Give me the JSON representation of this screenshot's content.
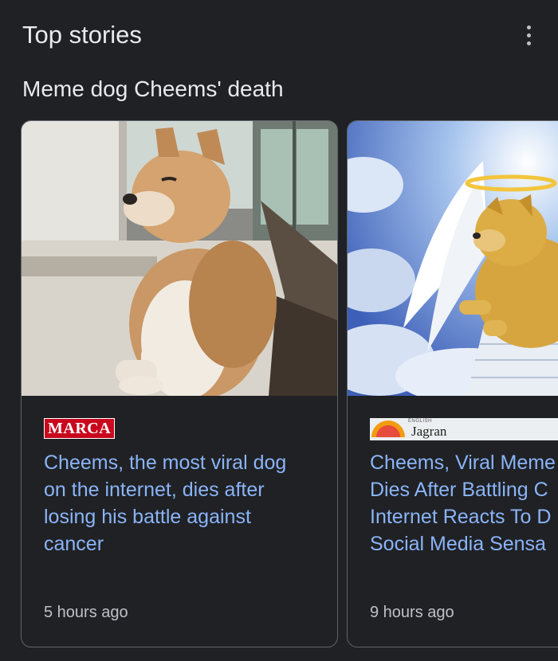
{
  "header": {
    "title": "Top stories",
    "more_icon": "more-vert-icon"
  },
  "topic": {
    "label": "Meme dog Cheems' death"
  },
  "colors": {
    "background": "#202124",
    "headline": "#8ab4f8",
    "text": "#e8eaed",
    "muted": "#bdc1c6",
    "border": "#5f6368"
  },
  "cards": [
    {
      "source": "MARCA",
      "headline_lines": [
        "Cheems, the most viral dog",
        "on the internet, dies after",
        "losing his battle against",
        "cancer"
      ],
      "time": "5 hours ago",
      "image": "shiba-inu-dog-photo"
    },
    {
      "source": "Jagran",
      "source_tag": "ENGLISH",
      "headline_lines": [
        "Cheems, Viral Meme",
        "Dies After Battling C",
        "Internet Reacts To D",
        "Social Media Sensa"
      ],
      "time": "9 hours ago",
      "image": "angel-dog-heaven-illustration"
    }
  ]
}
